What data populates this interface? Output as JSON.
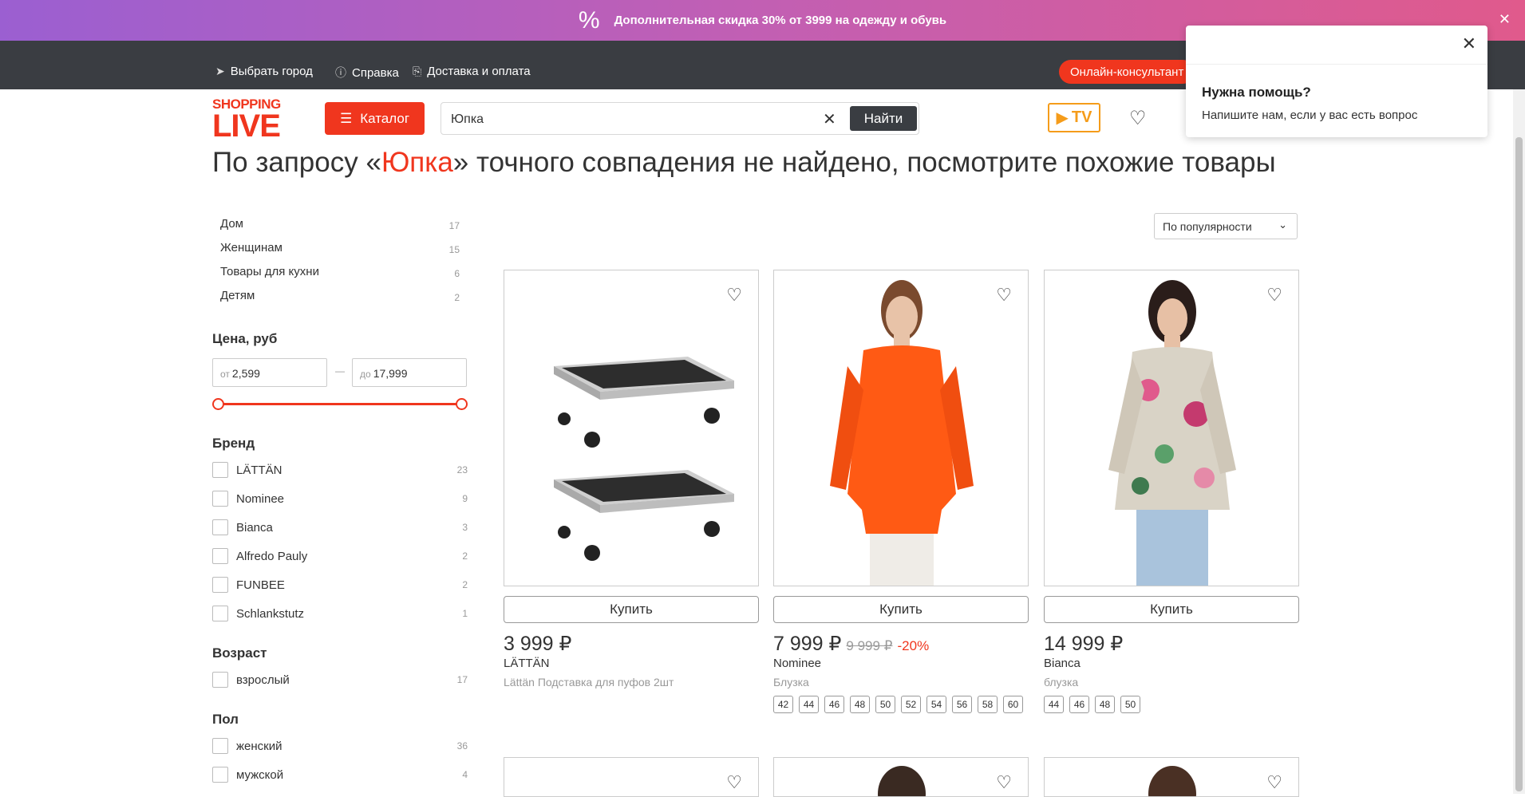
{
  "promo": {
    "icon": "percent-icon",
    "text": "Дополнительная скидка 30% от 3999 на одежду и обувь"
  },
  "topbar": {
    "city": "Выбрать город",
    "help": "Справка",
    "delivery": "Доставка и оплата",
    "consultant": "Онлайн-консультант"
  },
  "header": {
    "logo_line1": "SHOPPING",
    "logo_line2": "LIVE",
    "catalog": "Каталог",
    "search_value": "Юпка",
    "search_button": "Найти",
    "tv": "TV"
  },
  "help_popup": {
    "title": "Нужна помощь?",
    "subtitle": "Напишите нам, если у вас есть вопрос"
  },
  "result": {
    "prefix": "По запросу «",
    "query": "Юпка",
    "suffix": "» точного совпадения не найдено, посмотрите похожие товары"
  },
  "categories": [
    {
      "label": "Дом",
      "count": "17"
    },
    {
      "label": "Женщинам",
      "count": "15"
    },
    {
      "label": "Товары для кухни",
      "count": "6"
    },
    {
      "label": "Детям",
      "count": "2"
    }
  ],
  "price_filter": {
    "title": "Цена, руб",
    "from_prefix": "от",
    "from_value": "2,599",
    "to_prefix": "до",
    "to_value": "17,999",
    "dash": "—"
  },
  "brand_filter": {
    "title": "Бренд",
    "items": [
      {
        "label": "LÄTTÄN",
        "count": "23"
      },
      {
        "label": "Nominee",
        "count": "9"
      },
      {
        "label": "Bianca",
        "count": "3"
      },
      {
        "label": "Alfredo Pauly",
        "count": "2"
      },
      {
        "label": "FUNBEE",
        "count": "2"
      },
      {
        "label": "Schlankstutz",
        "count": "1"
      }
    ]
  },
  "age_filter": {
    "title": "Возраст",
    "items": [
      {
        "label": "взрослый",
        "count": "17"
      }
    ]
  },
  "gender_filter": {
    "title": "Пол",
    "items": [
      {
        "label": "женский",
        "count": "36"
      },
      {
        "label": "мужской",
        "count": "4"
      }
    ]
  },
  "sort": {
    "value": "По популярности"
  },
  "products": [
    {
      "price": "3 999 ₽",
      "old_price": "",
      "discount": "",
      "brand": "LÄTTÄN",
      "desc": "Lättän Подставка для пуфов 2шт",
      "buy": "Купить",
      "sizes": []
    },
    {
      "price": "7 999 ₽",
      "old_price": "9 999 ₽",
      "discount": "-20%",
      "brand": "Nominee",
      "desc": "Блузка",
      "buy": "Купить",
      "sizes": [
        "42",
        "44",
        "46",
        "48",
        "50",
        "52",
        "54",
        "56",
        "58",
        "60"
      ]
    },
    {
      "price": "14 999 ₽",
      "old_price": "",
      "discount": "",
      "brand": "Bianca",
      "desc": "блузка",
      "buy": "Купить",
      "sizes": [
        "44",
        "46",
        "48",
        "50"
      ]
    }
  ],
  "colors": {
    "accent": "#f0361e",
    "dark": "#3a3d42",
    "tv": "#f59c1a"
  }
}
